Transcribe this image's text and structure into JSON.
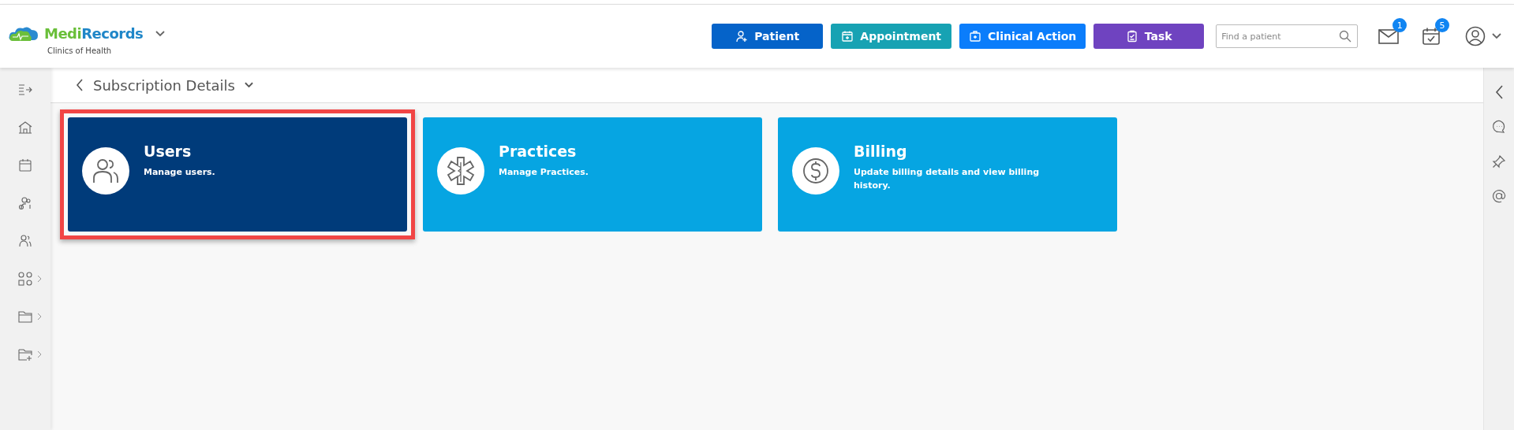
{
  "header": {
    "logo": {
      "name_part1": "Medi",
      "name_part2": "Records",
      "clinic": "Clinics of Health"
    },
    "actions": [
      {
        "label": "Patient",
        "color": "#0563c9"
      },
      {
        "label": "Appointment",
        "color": "#17a2b3"
      },
      {
        "label": "Clinical Action",
        "color": "#0b7dfb"
      },
      {
        "label": "Task",
        "color": "#6f43c0"
      }
    ],
    "search": {
      "placeholder": "Find a patient"
    },
    "mail_badge": "1",
    "calendar_badge": "5"
  },
  "sidebar": {
    "items": [
      {
        "expandable": false
      },
      {
        "expandable": false
      },
      {
        "expandable": false
      },
      {
        "expandable": false
      },
      {
        "expandable": false
      },
      {
        "expandable": true
      },
      {
        "expandable": true
      },
      {
        "expandable": true
      }
    ]
  },
  "page": {
    "title": "Subscription Details"
  },
  "cards": [
    {
      "title": "Users",
      "description": "Manage users.",
      "selected": true
    },
    {
      "title": "Practices",
      "description": "Manage Practices.",
      "selected": false
    },
    {
      "title": "Billing",
      "description": "Update billing details and view billing history.",
      "selected": false
    }
  ]
}
